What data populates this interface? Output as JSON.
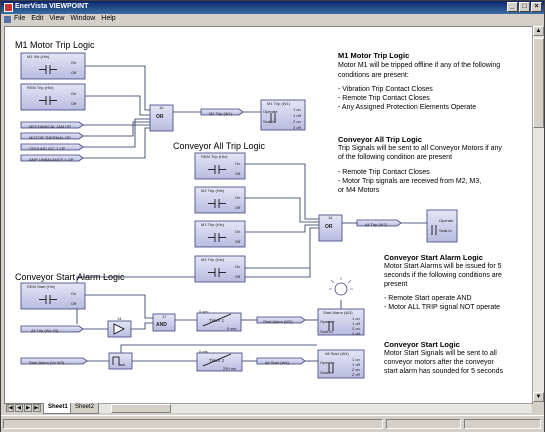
{
  "window": {
    "title": "EnerVista VIEWPOINT"
  },
  "menu": [
    "File",
    "Edit",
    "View",
    "Window",
    "Help"
  ],
  "tabs": [
    "Sheet1",
    "Sheet2"
  ],
  "headings": {
    "m1": "M1 Motor Trip Logic",
    "conveyor_all": "Conveyor All Trip Logic",
    "conveyor_start": "Conveyor Start Alarm Logic"
  },
  "blocks": {
    "m1_vib": "M1 Vib (HIx)",
    "rem_trip_m1": "REM Trip (HIx)",
    "mech_jam": "MECHANICAL JAM OP",
    "motor_thermal": "MOTOR THERMAL OP",
    "ground_oc": "GROUND IOC 1 OP",
    "amp_unbal": "AMP UNBALANCE 1 OP",
    "or1_num": "10",
    "or1": "OR",
    "m1_trip_sig": "M1 Trip (W1)",
    "m1_trip_relay": "M1 Trip (W1)",
    "rem_trip_conv": "REM Trip (HIx)",
    "m2_trip": "M2 Trip (HIx)",
    "m3_trip": "M3 Trip (HIx)",
    "m4_trip": "M4 Trip (HIx)",
    "or2_num": "14",
    "or2": "OR",
    "all_trip_sig": "All Trip (W2)",
    "all_trip_relay": "",
    "rem_start": "REM Start (HIx)",
    "all_trip_in": "All Trip (Wx 20)",
    "not_num": "14",
    "and_num": "17",
    "and": "AND",
    "timer1_hdr": "0 sec",
    "timer1": "Timer 1",
    "timer1_delay": "5 sec",
    "start_alarm_sig": "Start Alarm (W3)",
    "start_alarm_relay": "Start Alarm (W3)",
    "start_alarm_in": "Start Alarm (Vx W3)",
    "timer2_hdr": "0 ms",
    "timer2": "Timer 2",
    "timer2_delay": "250 ms",
    "all_start_sig": "All Start (W4)",
    "all_start_relay": "All Start (W4)",
    "port_on": "On",
    "port_off": "Off",
    "port_operate": "Operate",
    "port_seal_in": "Seal-In",
    "port_1on": "1 on",
    "port_1off": "1 off",
    "port_2on": "2 on",
    "port_2off": "2 off"
  },
  "descriptions": {
    "m1": {
      "title": "M1 Motor Trip Logic",
      "lines": [
        "Motor M1 will be tripped offline if any of the following",
        "conditions are present:"
      ],
      "bullets": [
        "- Vibration Trip Contact Closes",
        "- Remote Trip Contact Closes",
        "- Any Assigned Protection Elements Operate"
      ]
    },
    "conveyor_all": {
      "title": "Conveyor All Trip Logic",
      "lines": [
        "Trip Signals will be sent to all Conveyor Motors if any",
        "of the following condition are present"
      ],
      "bullets": [
        "- Remote Trip Contact Closes",
        "- Motor Trip signals are received from M2, M3,",
        "   or M4 Motors"
      ]
    },
    "conveyor_start": {
      "title": "Conveyor Start Alarm Logic",
      "lines": [
        "Motor Start Alarms will be issued for 5",
        "seconds if the following conditions are",
        "present"
      ],
      "bullets": [
        "- Remote Start operate AND",
        "- Motor ALL TRIP signal NOT operate"
      ]
    },
    "conveyor_start2": {
      "title": "Conveyor Start Logic",
      "lines": [
        "Motor Start Signals will be sent to all",
        "conveyor motors after the conveyor",
        "start alarm has sounded for 5 seconds"
      ]
    }
  },
  "colors": {
    "block": "#c8cae6",
    "block_border": "#3a3f7a",
    "wire": "#20305a",
    "canvas": "#ffffff"
  }
}
